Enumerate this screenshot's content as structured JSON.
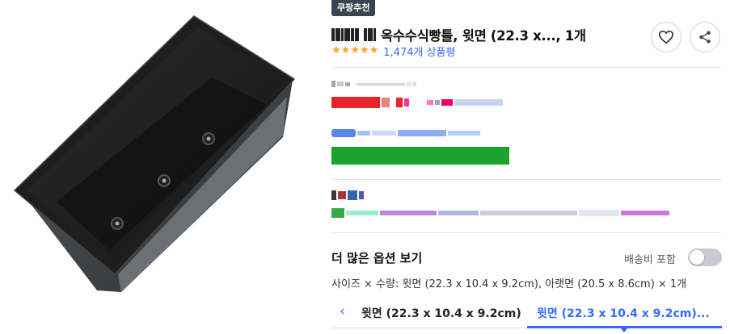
{
  "badge": {
    "label": "쿠팡추천"
  },
  "product": {
    "title": "옥수수식빵틀, 윗면 (22.3 x..., 1개",
    "rating_stars": 5,
    "review_count": "1,474개 상품평"
  },
  "icons": {
    "wishlist": "heart-outline-icon",
    "share": "share-icon",
    "rating": "star-icon",
    "prev": "chevron-left-icon"
  },
  "options": {
    "section_title": "더 많은 옵션 보기",
    "shipping_label": "배송비 포함",
    "shipping_toggle_on": false,
    "summary": "사이즈 × 수량: 윗면 (22.3 x 10.4 x 9.2cm), 아랫면 (20.5 x 8.6cm) × 1개",
    "tabs": [
      {
        "label": "윗면 (22.3 x 10.4 x 9.2cm)",
        "selected": false
      },
      {
        "label": "윗면 (22.3 x 10.4 x 9.2cm)...",
        "selected": true
      }
    ]
  },
  "colors": {
    "accent": "#346aff",
    "badge_bg": "#3a4450",
    "star": "#f5a623",
    "price_red": "#e52528",
    "promo_green": "#1aa32d"
  }
}
